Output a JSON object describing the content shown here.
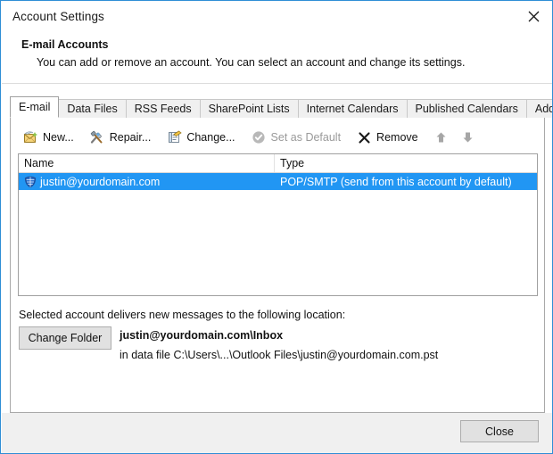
{
  "window": {
    "title": "Account Settings",
    "close_icon": "close-icon"
  },
  "header": {
    "title": "E-mail Accounts",
    "subtitle": "You can add or remove an account. You can select an account and change its settings."
  },
  "tabs": [
    {
      "label": "E-mail",
      "active": true
    },
    {
      "label": "Data Files",
      "active": false
    },
    {
      "label": "RSS Feeds",
      "active": false
    },
    {
      "label": "SharePoint Lists",
      "active": false
    },
    {
      "label": "Internet Calendars",
      "active": false
    },
    {
      "label": "Published Calendars",
      "active": false
    },
    {
      "label": "Address Books",
      "active": false
    }
  ],
  "toolbar": {
    "new_label": "New...",
    "repair_label": "Repair...",
    "change_label": "Change...",
    "set_default_label": "Set as Default",
    "remove_label": "Remove",
    "move_up_label": "",
    "move_down_label": "",
    "new_icon": "new-mail-icon",
    "repair_icon": "repair-tools-icon",
    "change_icon": "change-settings-icon",
    "set_default_icon": "check-circle-icon",
    "remove_icon": "x-remove-icon",
    "move_up_icon": "arrow-up-icon",
    "move_down_icon": "arrow-down-icon"
  },
  "accounts_list": {
    "columns": [
      "Name",
      "Type"
    ],
    "rows": [
      {
        "icon": "account-shield-icon",
        "name": "justin@yourdomain.com",
        "type": "POP/SMTP (send from this account by default)",
        "selected": true
      }
    ]
  },
  "delivery": {
    "label": "Selected account delivers new messages to the following location:",
    "change_folder_label": "Change Folder",
    "path": "justin@yourdomain.com\\Inbox",
    "data_file": "in data file C:\\Users\\...\\Outlook Files\\justin@yourdomain.com.pst"
  },
  "footer": {
    "close_label": "Close"
  },
  "colors": {
    "selection": "#2196f3",
    "window_border": "#2f8ed6",
    "footer_bg": "#f0f0f0",
    "button_bg": "#e1e1e1"
  }
}
